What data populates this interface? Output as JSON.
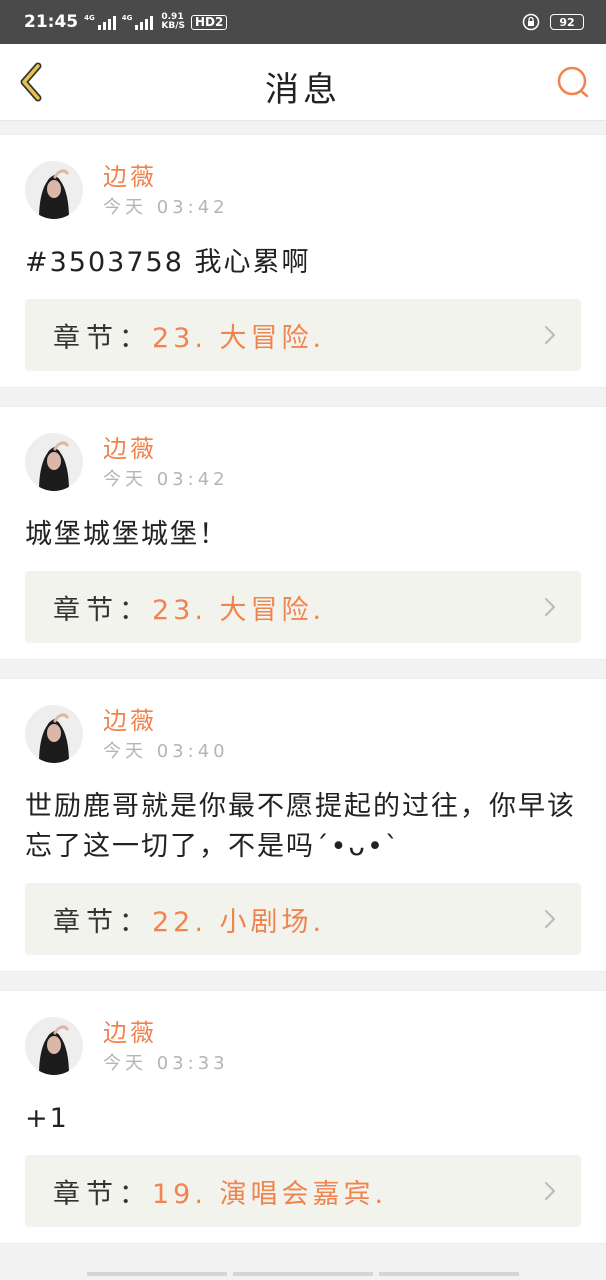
{
  "status_bar": {
    "time": "21:45",
    "network_1": "4G",
    "network_2": "4G",
    "speed_value": "0.91",
    "speed_unit": "KB/S",
    "hd_label": "HD2",
    "battery": "92"
  },
  "header": {
    "title": "消息",
    "back_icon": "chevron-left-icon",
    "search_icon": "search-icon"
  },
  "comments": [
    {
      "author": "边薇",
      "time": "今天 03:42",
      "content": "#3503758 我心累啊",
      "chapter_label": "章节：",
      "chapter": "23. 大冒险."
    },
    {
      "author": "边薇",
      "time": "今天 03:42",
      "content": "城堡城堡城堡！",
      "chapter_label": "章节：",
      "chapter": "23. 大冒险."
    },
    {
      "author": "边薇",
      "time": "今天 03:40",
      "content": "世励鹿哥就是你最不愿提起的过往，你早该忘了这一切了，不是吗´•ᴗ•`",
      "chapter_label": "章节：",
      "chapter": "22. 小剧场."
    },
    {
      "author": "边薇",
      "time": "今天 03:33",
      "content": "+1",
      "chapter_label": "章节：",
      "chapter": "19. 演唱会嘉宾."
    }
  ],
  "colors": {
    "accent": "#f0844f",
    "status_bar_bg": "#4a4a4a",
    "chapter_bg": "#f3f3ee"
  }
}
